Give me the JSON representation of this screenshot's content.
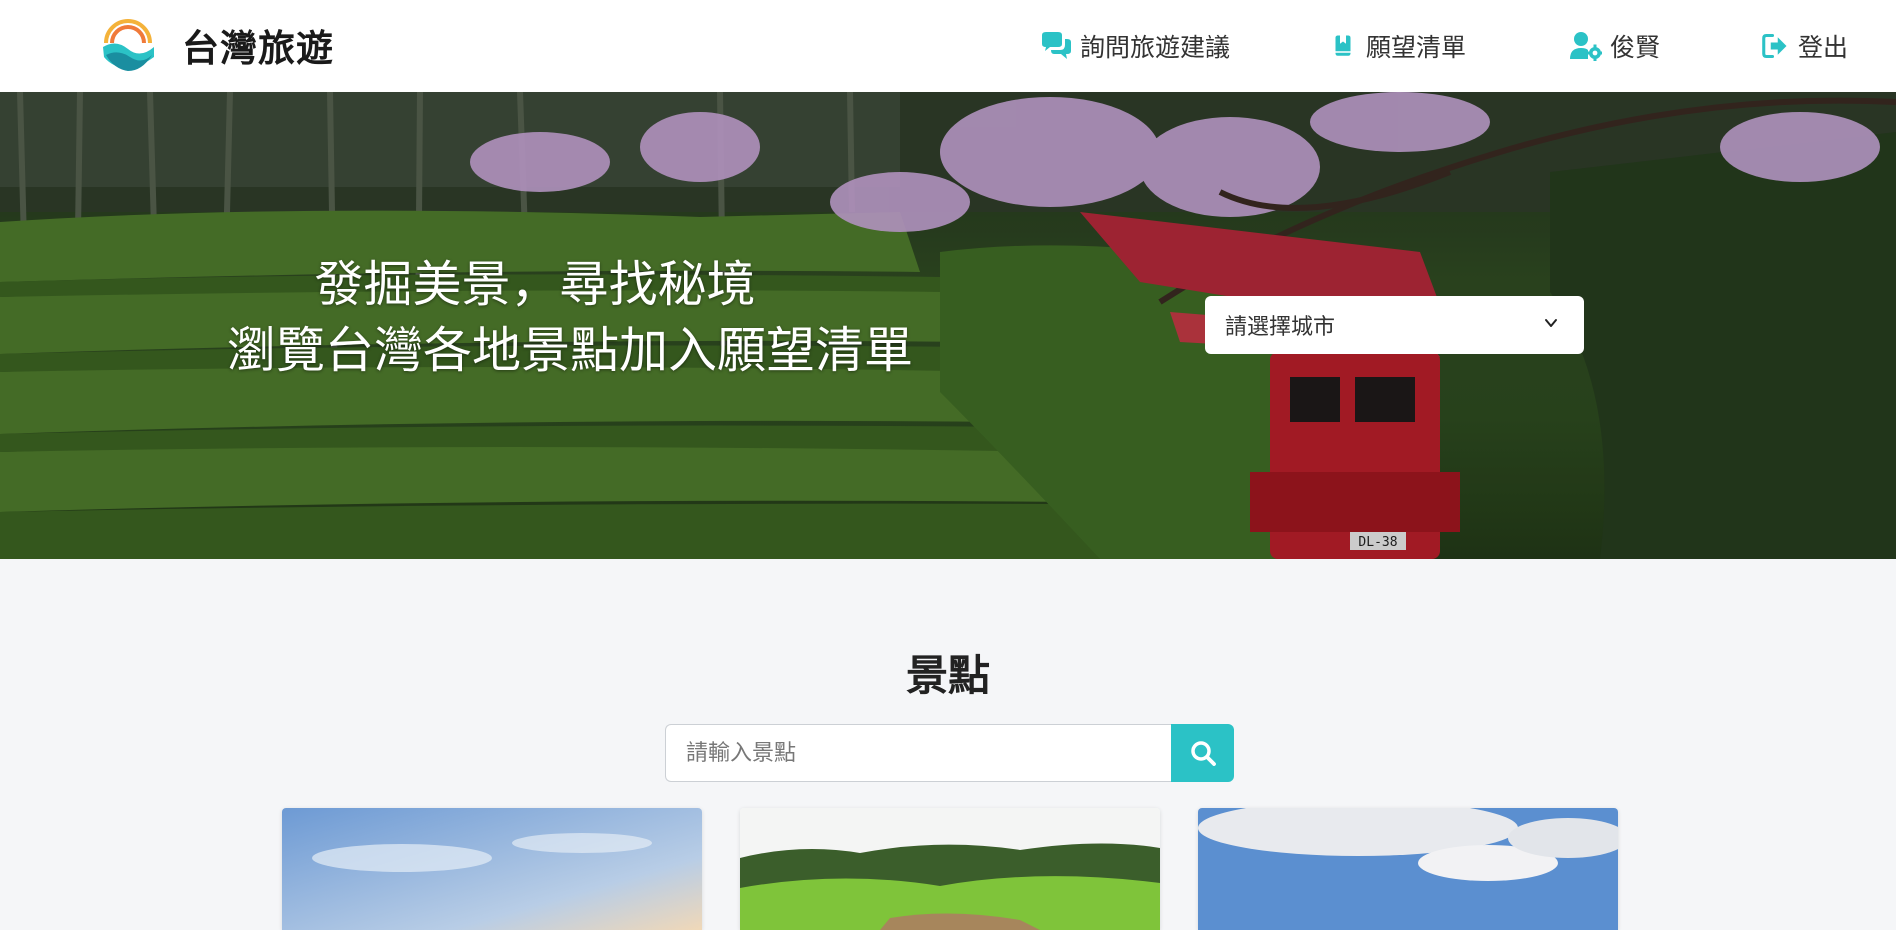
{
  "brand": {
    "title": "台灣旅遊"
  },
  "nav": {
    "consult_label": "詢問旅遊建議",
    "wishlist_label": "願望清單",
    "user_label": "俊賢",
    "logout_label": "登出"
  },
  "hero": {
    "line1": "發掘美景，尋找秘境",
    "line2": "瀏覽台灣各地景點加入願望清單",
    "city_select": {
      "selected": "請選擇城市"
    },
    "train_plate": "DL-38"
  },
  "attractions": {
    "title": "景點",
    "search_placeholder": "請輸入景點"
  },
  "colors": {
    "accent": "#2bc2c6",
    "page_bg": "#f5f6f8"
  },
  "icons": {
    "consult": "comments-icon",
    "wishlist": "bookmark-book-icon",
    "user": "user-gear-icon",
    "logout": "sign-out-icon",
    "search": "search-icon",
    "select": "chevron-down-icon"
  }
}
